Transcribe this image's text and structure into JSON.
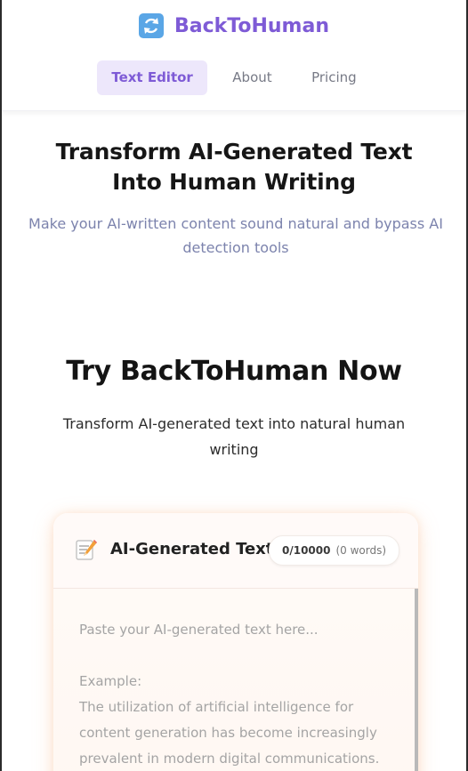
{
  "header": {
    "brand_icon": "arrows-cycle-icon",
    "brand_name": "BackToHuman",
    "brand_color": "#7e5bd6",
    "nav": [
      {
        "label": "Text Editor",
        "active": true
      },
      {
        "label": "About",
        "active": false
      },
      {
        "label": "Pricing",
        "active": false
      }
    ]
  },
  "hero": {
    "title": "Transform AI-Generated Text Into Human Writing",
    "subtitle": "Make your AI-written content sound natural and bypass AI detection tools"
  },
  "try_section": {
    "title": "Try BackToHuman Now",
    "subtitle": "Transform AI-generated text into natural human writing"
  },
  "input_card": {
    "icon": "memo-icon",
    "title": "AI-Generated Text",
    "char_count": "0/10000",
    "word_count": "(0 words)",
    "placeholder": "Paste your AI-generated text here...\n\nExample:\nThe utilization of artificial intelligence for content generation has become increasingly prevalent in modern digital communications."
  }
}
